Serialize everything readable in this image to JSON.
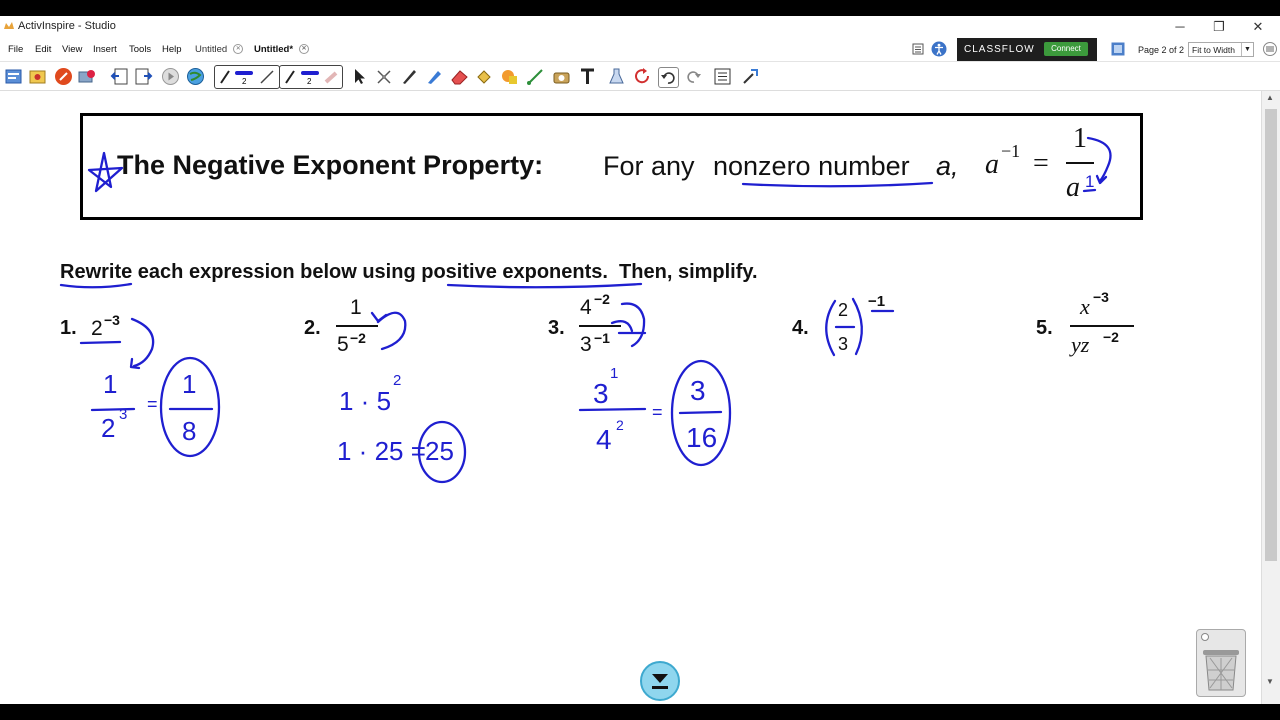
{
  "window": {
    "title": "ActivInspire - Studio",
    "min": "─",
    "restore": "❐",
    "close": "✕"
  },
  "menu": {
    "items": [
      "File",
      "Edit",
      "View",
      "Insert",
      "Tools",
      "Help"
    ],
    "tabs": [
      {
        "label": "Untitled"
      },
      {
        "label": "Untitled*"
      }
    ]
  },
  "classflow": {
    "brand": "CLASSFLOW",
    "connect": "Connect"
  },
  "page": {
    "indicator": "Page 2 of 2",
    "zoom": "Fit to Width"
  },
  "pen_widths": [
    "2",
    "2"
  ],
  "colors": {
    "ink_blue": "#1f1fd0",
    "accent_green": "#3c9a3c",
    "classflow_bg": "#1e1e1e"
  },
  "flipchart": {
    "property": {
      "title": "The Negative Exponent Property:",
      "text_before": "For any",
      "underlined": "nonzero number",
      "variable": "a,",
      "formula_base": "a",
      "formula_exp": "−1",
      "equals": "=",
      "numerator": "1",
      "denominator_base": "a",
      "handwritten_exp": "1"
    },
    "instruction": {
      "word1": "Rewrite",
      "middle": " each expression below using ",
      "word2": "positive exponents",
      "end": ".  Then, simplify."
    },
    "problems": [
      {
        "num": "1.",
        "base": "2",
        "exp": "−3"
      },
      {
        "num": "2.",
        "numerator": "1",
        "den_base": "5",
        "den_exp": "−2"
      },
      {
        "num": "3.",
        "num_base": "4",
        "num_exp": "−2",
        "den_base": "3",
        "den_exp": "−1"
      },
      {
        "num": "4.",
        "top": "2",
        "bottom": "3",
        "exp": "−1"
      },
      {
        "num": "5.",
        "num_base": "x",
        "num_exp": "−3",
        "den": "yz",
        "den_exp": "−2"
      }
    ],
    "work": {
      "p1": {
        "numerator": "1",
        "den_base": "2",
        "den_exp": "3",
        "eq": "=",
        "answer_num": "1",
        "answer_den": "8"
      },
      "p2": {
        "line1": "1 · 5",
        "line1_exp": "2",
        "line2": "1 · 25 =",
        "answer": "25"
      },
      "p3": {
        "num_base": "3",
        "num_exp": "1",
        "den_base": "4",
        "den_exp": "2",
        "eq": "=",
        "answer_num": "3",
        "answer_den": "16"
      }
    }
  }
}
